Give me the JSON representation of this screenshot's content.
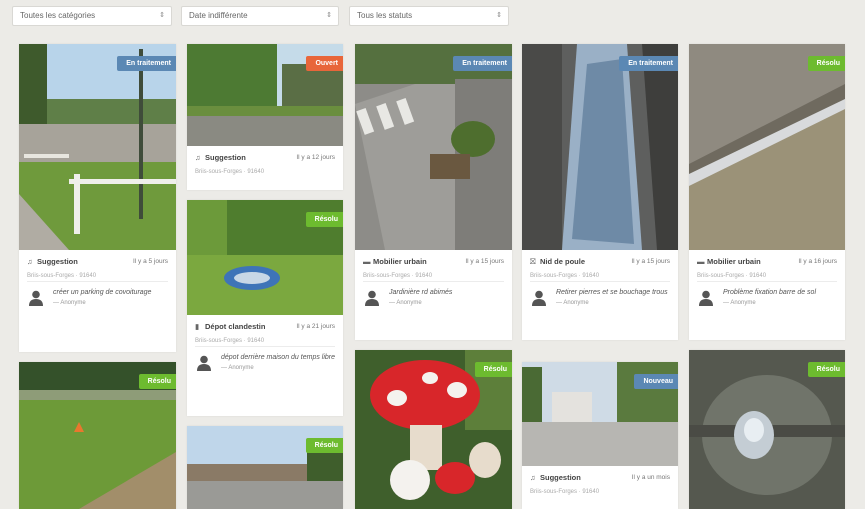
{
  "filters": {
    "category": "Toutes les catégories",
    "date": "Date indifférente",
    "status": "Tous les statuts"
  },
  "colors": {
    "resolu": "#6dbb2f",
    "en_traitement": "#5b88b4",
    "ouvert": "#e8663a"
  },
  "address": "Briis-sous-Forges · 91640",
  "anonymous": "— Anonyme",
  "cards": [
    {
      "status": "En traitement",
      "category": "Suggestion",
      "icon": "bell-icon",
      "ago": "Il y a 5 jours",
      "comment": "créer un parking de covoiturage",
      "author": "— Anonyme"
    },
    {
      "status": "Ouvert",
      "category": "Suggestion",
      "icon": "bell-icon",
      "ago": "Il y a 12 jours",
      "comment": "",
      "author": ""
    },
    {
      "status": "Résolu",
      "category": "Dépot clandestin",
      "icon": "trash-icon",
      "ago": "Il y a 21 jours",
      "comment": "dépot derrière maison du temps libre",
      "author": "— Anonyme"
    },
    {
      "status": "En traitement",
      "category": "Mobilier urbain",
      "icon": "bench-icon",
      "ago": "Il y a 15 jours",
      "comment": "Jardinière rd abimés",
      "author": "— Anonyme"
    },
    {
      "status": "En traitement",
      "category": "Nid de poule",
      "icon": "road-icon",
      "ago": "Il y a 15 jours",
      "comment": "Retirer pierres et se bouchage trous",
      "author": "— Anonyme"
    },
    {
      "status": "Résolu",
      "category": "Mobilier urbain",
      "icon": "bench-icon",
      "ago": "Il y a 16 jours",
      "comment": "Problème fixation barre de sol",
      "author": "— Anonyme"
    },
    {
      "status": "Résolu"
    },
    {
      "status": "Résolu"
    },
    {
      "status": "Résolu"
    },
    {
      "status": "Nouveau",
      "category": "Suggestion",
      "icon": "bell-icon",
      "ago": "Il y a un mois",
      "comment": "",
      "author": ""
    },
    {
      "status": "Résolu"
    }
  ]
}
